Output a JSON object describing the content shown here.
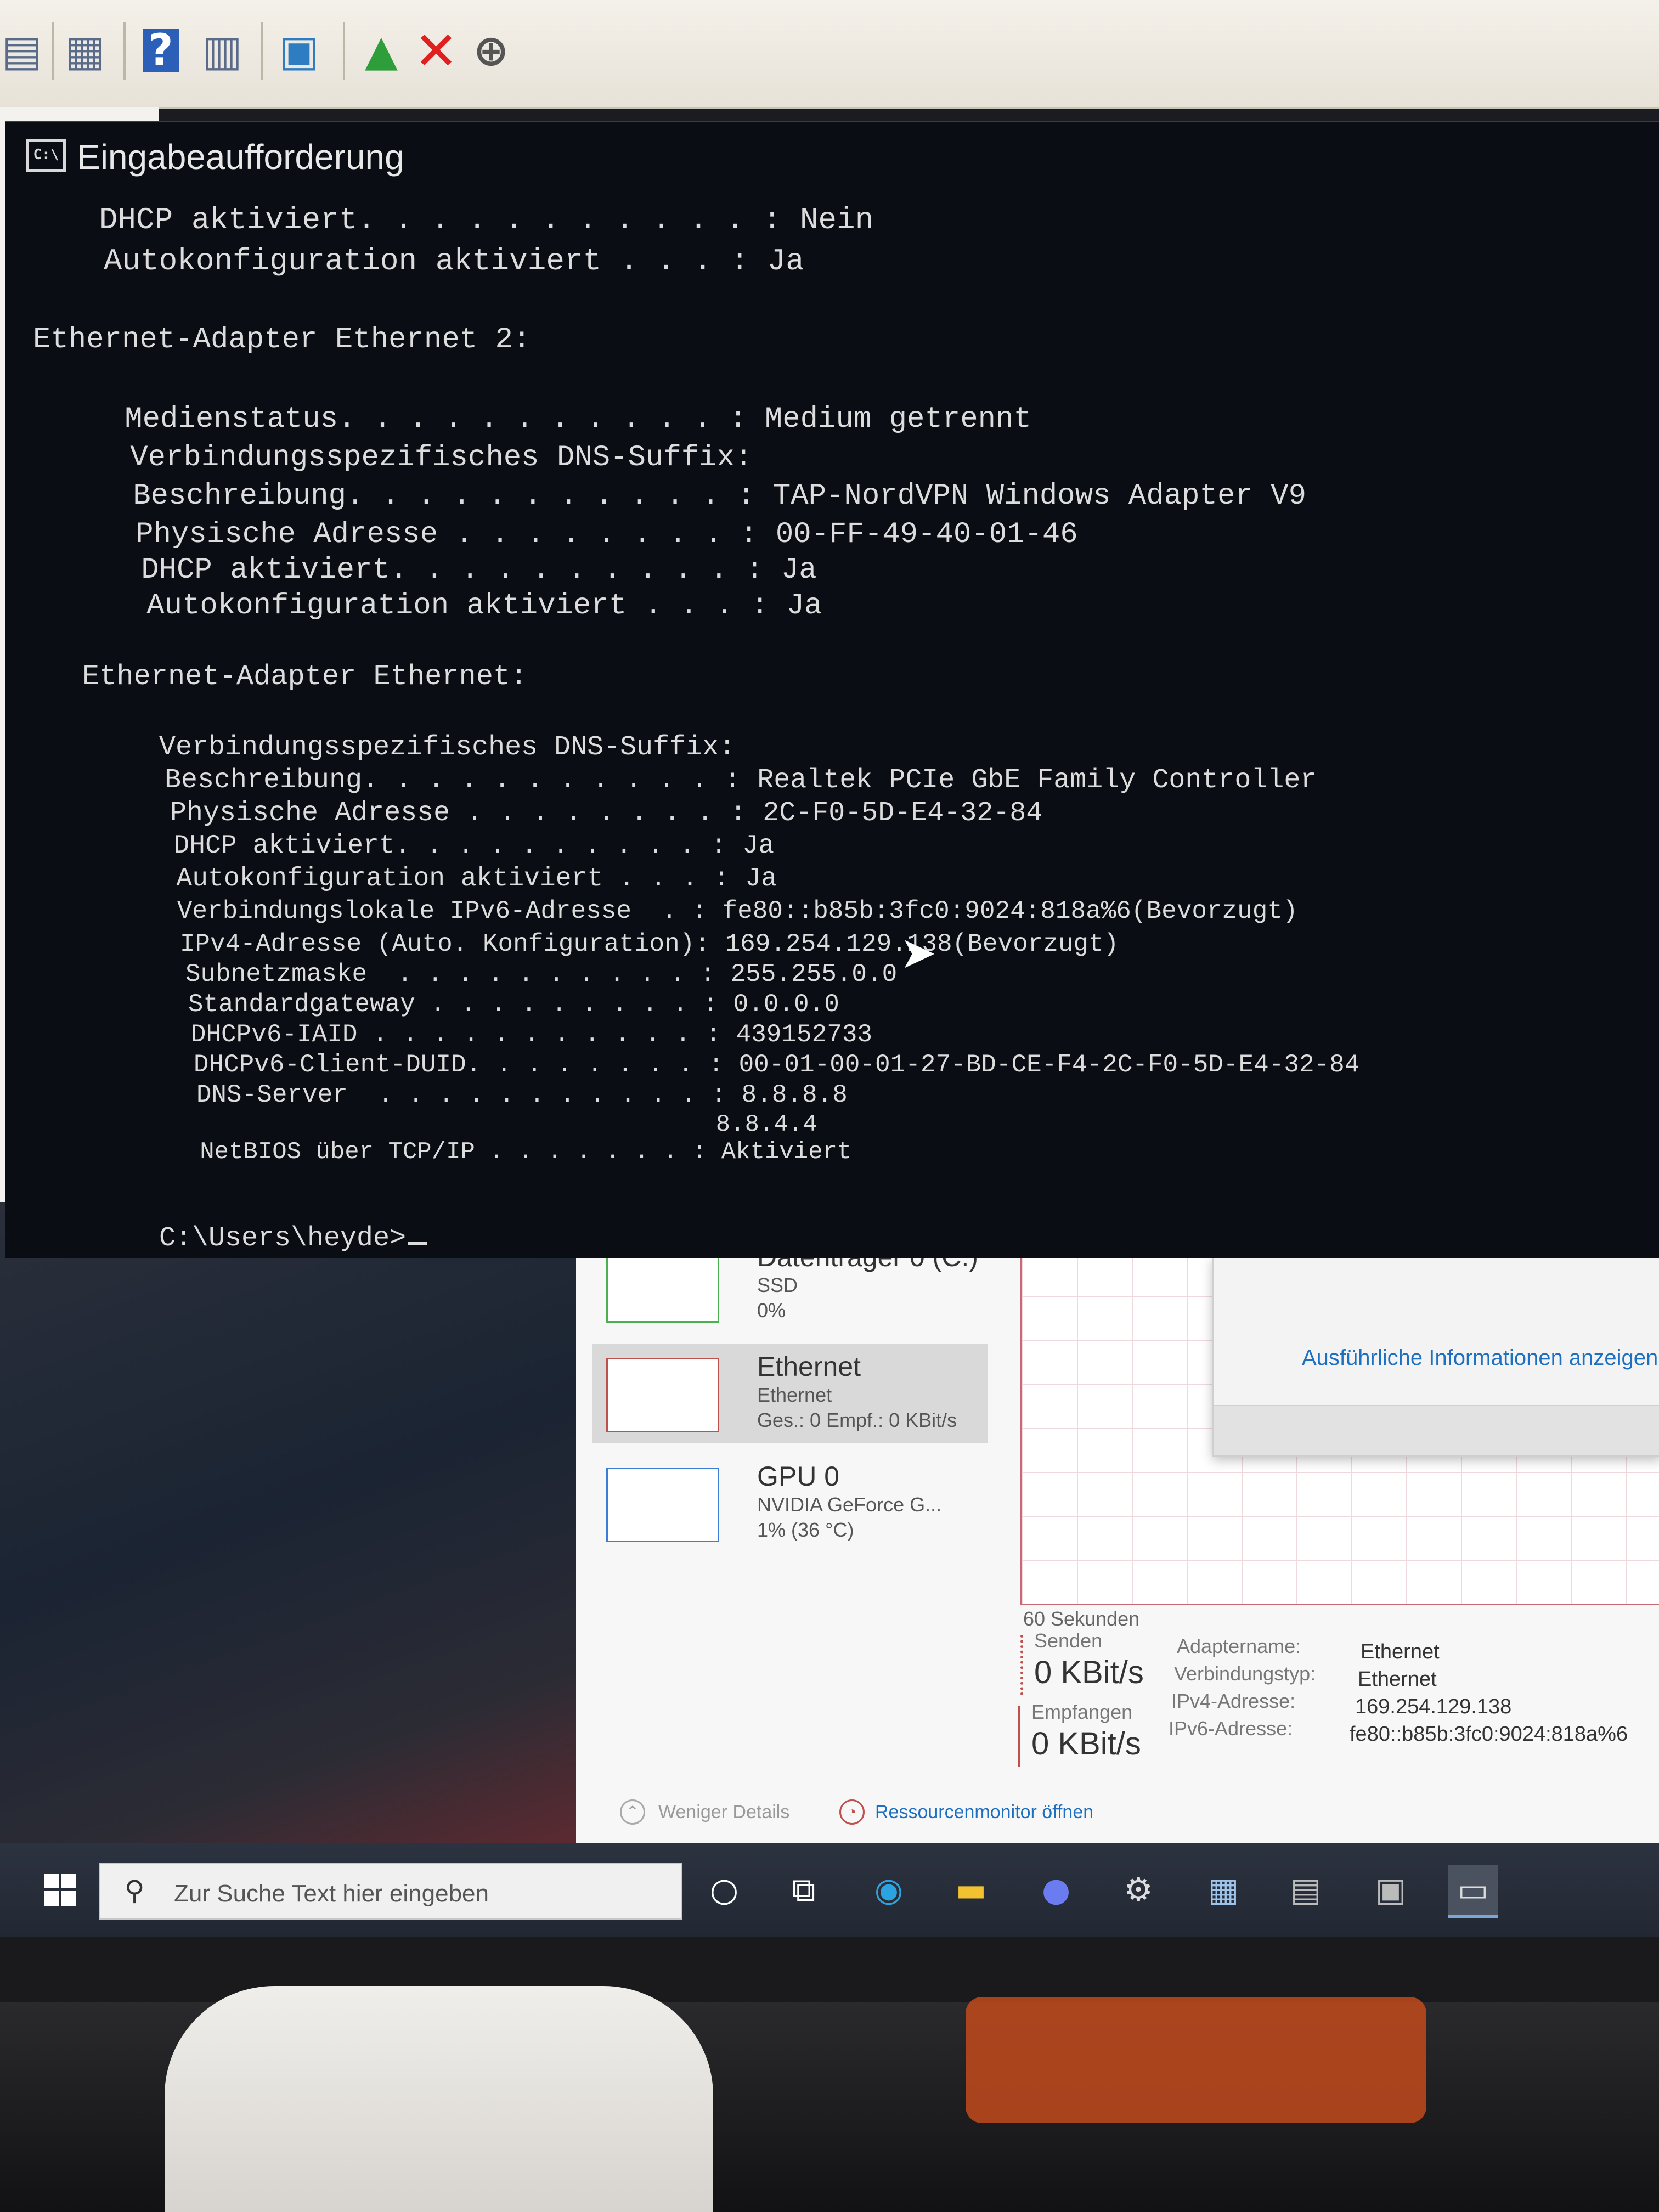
{
  "mmc_toolbar": {
    "icons": [
      "list-icon",
      "properties-icon",
      "help-icon",
      "view-icon",
      "monitor-icon",
      "add-driver-icon",
      "delete-icon",
      "download-icon"
    ]
  },
  "device_tree": {
    "rows": [
      "audio-icon",
      "display-icon",
      "printer-icon",
      "computer-icon",
      "keyboard-icon",
      "drive-icon",
      "mouse-icon",
      "monitor-icon",
      "network-icon"
    ]
  },
  "cmd": {
    "title": "Eingabeaufforderung",
    "icon_text": "C:\\",
    "prompt": "C:\\Users\\heyde>",
    "lines": [
      {
        "key": "   DHCP aktiviert. . . . . . . . . . . : ",
        "value": "Nein"
      },
      {
        "key": "   Autokonfiguration aktiviert . . . : ",
        "value": "Ja"
      },
      {
        "key": "Ethernet-Adapter Ethernet 2:",
        "value": ""
      },
      {
        "key": "   Medienstatus. . . . . . . . . . . : ",
        "value": "Medium getrennt"
      },
      {
        "key": "   Verbindungsspezifisches DNS-Suffix: ",
        "value": ""
      },
      {
        "key": "   Beschreibung. . . . . . . . . . . : ",
        "value": "TAP-NordVPN Windows Adapter V9"
      },
      {
        "key": "   Physische Adresse . . . . . . . . : ",
        "value": "00-FF-49-40-01-46"
      },
      {
        "key": "   DHCP aktiviert. . . . . . . . . . : ",
        "value": "Ja"
      },
      {
        "key": "   Autokonfiguration aktiviert . . . : ",
        "value": "Ja"
      },
      {
        "key": "Ethernet-Adapter Ethernet:",
        "value": ""
      },
      {
        "key": "   Verbindungsspezifisches DNS-Suffix: ",
        "value": ""
      },
      {
        "key": "   Beschreibung. . . . . . . . . . . : ",
        "value": "Realtek PCIe GbE Family Controller"
      },
      {
        "key": "   Physische Adresse . . . . . . . . : ",
        "value": "2C-F0-5D-E4-32-84"
      },
      {
        "key": "   DHCP aktiviert. . . . . . . . . . : ",
        "value": "Ja"
      },
      {
        "key": "   Autokonfiguration aktiviert . . . : ",
        "value": "Ja"
      },
      {
        "key": "   Verbindungslokale IPv6-Adresse  . : ",
        "value": "fe80::b85b:3fc0:9024:818a%6(Bevorzugt)"
      },
      {
        "key": "   IPv4-Adresse (Auto. Konfiguration): ",
        "value": "169.254.129.138(Bevorzugt)"
      },
      {
        "key": "   Subnetzmaske  . . . . . . . . . . : ",
        "value": "255.255.0.0"
      },
      {
        "key": "   Standardgateway . . . . . . . . . : ",
        "value": "0.0.0.0"
      },
      {
        "key": "   DHCPv6-IAID . . . . . . . . . . . : ",
        "value": "439152733"
      },
      {
        "key": "   DHCPv6-Client-DUID. . . . . . . . : ",
        "value": "00-01-00-01-27-BD-CE-F4-2C-F0-5D-E4-32-84"
      },
      {
        "key": "   DNS-Server  . . . . . . . . . . . : ",
        "value": "8.8.8.8"
      },
      {
        "key": "                                       ",
        "value": "8.8.4.4"
      },
      {
        "key": "   NetBIOS über TCP/IP . . . . . . . : ",
        "value": "Aktiviert"
      }
    ]
  },
  "taskmgr": {
    "items": [
      {
        "title": "Datenträger 0 (C:)",
        "sub": "SSD",
        "sub2": "0%",
        "color": "#4caf50"
      },
      {
        "title": "Ethernet",
        "sub": "Ethernet",
        "sub2": "Ges.: 0 Empf.: 0 KBit/s",
        "color": "#c0504d"
      },
      {
        "title": "GPU 0",
        "sub": "NVIDIA GeForce G...",
        "sub2": "1% (36 °C)",
        "color": "#3b7dd8"
      }
    ],
    "popup_link": "Ausführliche Informationen anzeigen",
    "graph_caption": "60 Sekunden",
    "send_label": "Senden",
    "send_value": "0 KBit/s",
    "recv_label": "Empfangen",
    "recv_value": "0 KBit/s",
    "info": [
      {
        "k": "Adaptername:",
        "v": "Ethernet"
      },
      {
        "k": "Verbindungstyp:",
        "v": "Ethernet"
      },
      {
        "k": "IPv4-Adresse:",
        "v": "169.254.129.138"
      },
      {
        "k": "IPv6-Adresse:",
        "v": "fe80::b85b:3fc0:9024:818a%6"
      }
    ],
    "less_details": "Weniger Details",
    "resource_monitor": "Ressourcenmonitor öffnen"
  },
  "taskbar": {
    "search_placeholder": "Zur Suche Text hier eingeben",
    "apps": [
      "cortana-icon",
      "task-view-icon",
      "edge-icon",
      "file-explorer-icon",
      "discord-icon",
      "settings-icon",
      "network-app-icon",
      "device-manager-icon",
      "remote-icon",
      "cmd-icon"
    ]
  }
}
